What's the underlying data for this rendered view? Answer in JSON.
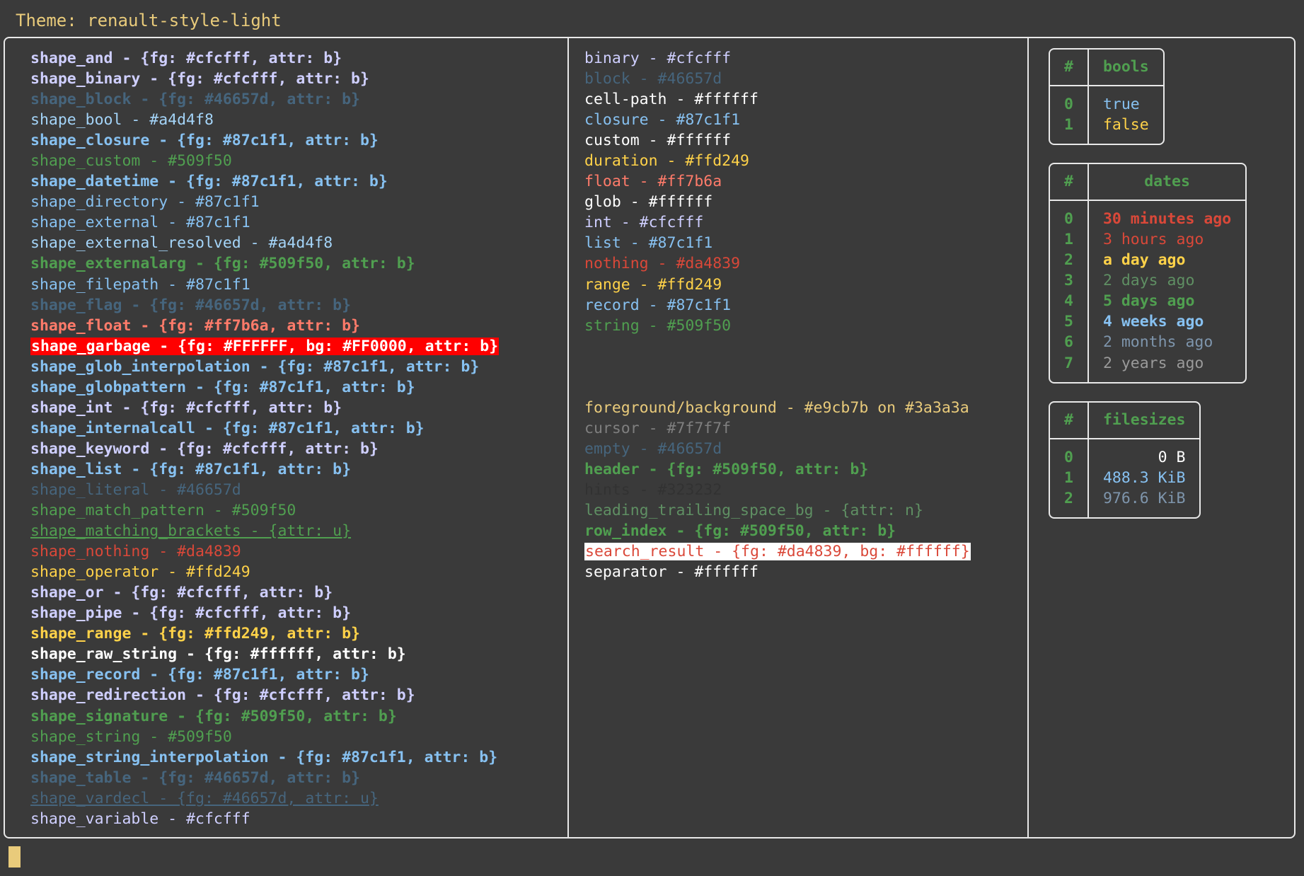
{
  "theme": {
    "title": "Theme: renault-style-light",
    "title_color": "#e9cb7b",
    "background": "#3a3a3a",
    "border_color": "#e8e8e8",
    "cursor_color": "#e9cb7b"
  },
  "shapes": [
    {
      "text": "shape_and - {fg: #cfcfff, attr: b}",
      "color": "#cfcfff",
      "bold": true
    },
    {
      "text": "shape_binary - {fg: #cfcfff, attr: b}",
      "color": "#cfcfff",
      "bold": true
    },
    {
      "text": "shape_block - {fg: #46657d, attr: b}",
      "color": "#46657d",
      "bold": true
    },
    {
      "text": "shape_bool - #a4d4f8",
      "color": "#a4d4f8",
      "bold": false
    },
    {
      "text": "shape_closure - {fg: #87c1f1, attr: b}",
      "color": "#87c1f1",
      "bold": true
    },
    {
      "text": "shape_custom - #509f50",
      "color": "#509f50",
      "bold": false
    },
    {
      "text": "shape_datetime - {fg: #87c1f1, attr: b}",
      "color": "#87c1f1",
      "bold": true
    },
    {
      "text": "shape_directory - #87c1f1",
      "color": "#87c1f1",
      "bold": false
    },
    {
      "text": "shape_external - #87c1f1",
      "color": "#87c1f1",
      "bold": false
    },
    {
      "text": "shape_external_resolved - #a4d4f8",
      "color": "#a4d4f8",
      "bold": false
    },
    {
      "text": "shape_externalarg - {fg: #509f50, attr: b}",
      "color": "#509f50",
      "bold": true
    },
    {
      "text": "shape_filepath - #87c1f1",
      "color": "#87c1f1",
      "bold": false
    },
    {
      "text": "shape_flag - {fg: #46657d, attr: b}",
      "color": "#46657d",
      "bold": true
    },
    {
      "text": "shape_float - {fg: #ff7b6a, attr: b}",
      "color": "#ff7b6a",
      "bold": true
    },
    {
      "text": "shape_garbage - {fg: #FFFFFF, bg: #FF0000, attr: b}",
      "color": "#FFFFFF",
      "bg": "#FF0000",
      "bold": true
    },
    {
      "text": "shape_glob_interpolation - {fg: #87c1f1, attr: b}",
      "color": "#87c1f1",
      "bold": true
    },
    {
      "text": "shape_globpattern - {fg: #87c1f1, attr: b}",
      "color": "#87c1f1",
      "bold": true
    },
    {
      "text": "shape_int - {fg: #cfcfff, attr: b}",
      "color": "#cfcfff",
      "bold": true
    },
    {
      "text": "shape_internalcall - {fg: #87c1f1, attr: b}",
      "color": "#87c1f1",
      "bold": true
    },
    {
      "text": "shape_keyword - {fg: #cfcfff, attr: b}",
      "color": "#cfcfff",
      "bold": true
    },
    {
      "text": "shape_list - {fg: #87c1f1, attr: b}",
      "color": "#87c1f1",
      "bold": true
    },
    {
      "text": "shape_literal - #46657d",
      "color": "#46657d",
      "bold": false
    },
    {
      "text": "shape_match_pattern - #509f50",
      "color": "#509f50",
      "bold": false
    },
    {
      "text": "shape_matching_brackets - {attr: u}",
      "color": "#509f50",
      "bold": false,
      "underline": true
    },
    {
      "text": "shape_nothing - #da4839",
      "color": "#da4839",
      "bold": false
    },
    {
      "text": "shape_operator - #ffd249",
      "color": "#ffd249",
      "bold": false
    },
    {
      "text": "shape_or - {fg: #cfcfff, attr: b}",
      "color": "#cfcfff",
      "bold": true
    },
    {
      "text": "shape_pipe - {fg: #cfcfff, attr: b}",
      "color": "#cfcfff",
      "bold": true
    },
    {
      "text": "shape_range - {fg: #ffd249, attr: b}",
      "color": "#ffd249",
      "bold": true
    },
    {
      "text": "shape_raw_string - {fg: #ffffff, attr: b}",
      "color": "#ffffff",
      "bold": true
    },
    {
      "text": "shape_record - {fg: #87c1f1, attr: b}",
      "color": "#87c1f1",
      "bold": true
    },
    {
      "text": "shape_redirection - {fg: #cfcfff, attr: b}",
      "color": "#cfcfff",
      "bold": true
    },
    {
      "text": "shape_signature - {fg: #509f50, attr: b}",
      "color": "#509f50",
      "bold": true
    },
    {
      "text": "shape_string - #509f50",
      "color": "#509f50",
      "bold": false
    },
    {
      "text": "shape_string_interpolation - {fg: #87c1f1, attr: b}",
      "color": "#87c1f1",
      "bold": true
    },
    {
      "text": "shape_table - {fg: #46657d, attr: b}",
      "color": "#46657d",
      "bold": true
    },
    {
      "text": "shape_vardecl - {fg: #46657d, attr: u}",
      "color": "#46657d",
      "bold": false,
      "underline": true
    },
    {
      "text": "shape_variable - #cfcfff",
      "color": "#cfcfff",
      "bold": false
    }
  ],
  "types": [
    {
      "text": "binary - #cfcfff",
      "color": "#cfcfff",
      "bold": false
    },
    {
      "text": "block - #46657d",
      "color": "#46657d",
      "bold": false
    },
    {
      "text": "cell-path - #ffffff",
      "color": "#ffffff",
      "bold": false
    },
    {
      "text": "closure - #87c1f1",
      "color": "#87c1f1",
      "bold": false
    },
    {
      "text": "custom - #ffffff",
      "color": "#ffffff",
      "bold": false
    },
    {
      "text": "duration - #ffd249",
      "color": "#ffd249",
      "bold": false
    },
    {
      "text": "float - #ff7b6a",
      "color": "#ff7b6a",
      "bold": false
    },
    {
      "text": "glob - #ffffff",
      "color": "#ffffff",
      "bold": false
    },
    {
      "text": "int - #cfcfff",
      "color": "#cfcfff",
      "bold": false
    },
    {
      "text": "list - #87c1f1",
      "color": "#87c1f1",
      "bold": false
    },
    {
      "text": "nothing - #da4839",
      "color": "#da4839",
      "bold": false
    },
    {
      "text": "range - #ffd249",
      "color": "#ffd249",
      "bold": false
    },
    {
      "text": "record - #87c1f1",
      "color": "#87c1f1",
      "bold": false
    },
    {
      "text": "string - #509f50",
      "color": "#509f50",
      "bold": false
    }
  ],
  "ui_elements": [
    {
      "text": "foreground/background - #e9cb7b on #3a3a3a",
      "color": "#e9cb7b",
      "bold": false
    },
    {
      "text": "cursor - #7f7f7f",
      "color": "#7f7f7f",
      "bold": false
    },
    {
      "text": "empty - #46657d",
      "color": "#46657d",
      "bold": false
    },
    {
      "text": "header - {fg: #509f50, attr: b}",
      "color": "#509f50",
      "bold": true
    },
    {
      "text": "hints - #323232",
      "color": "#323232",
      "bold": false
    },
    {
      "text": "leading_trailing_space_bg - {attr: n}",
      "color": "#5f8f63",
      "bold": false
    },
    {
      "text": "row_index - {fg: #509f50, attr: b}",
      "color": "#509f50",
      "bold": true
    },
    {
      "text": "search_result - {fg: #da4839, bg: #ffffff}",
      "color": "#da4839",
      "bg": "#ffffff",
      "bold": false
    },
    {
      "text": "separator - #ffffff",
      "color": "#ffffff",
      "bold": false
    }
  ],
  "tables": [
    {
      "name": "bools",
      "index_header": "#",
      "value_header": "bools",
      "header_align": "center",
      "value_align": "left",
      "rows": [
        {
          "index": "0",
          "value": "true",
          "color": "#87c1f1",
          "bold": false
        },
        {
          "index": "1",
          "value": "false",
          "color": "#ffd249",
          "bold": false
        }
      ]
    },
    {
      "name": "dates",
      "index_header": "#",
      "value_header": "dates",
      "header_align": "center",
      "value_align": "left",
      "rows": [
        {
          "index": "0",
          "value": "30 minutes ago",
          "color": "#da4839",
          "bold": true
        },
        {
          "index": "1",
          "value": "3 hours ago",
          "color": "#da4839",
          "bold": false
        },
        {
          "index": "2",
          "value": "a day ago",
          "color": "#ffd249",
          "bold": true
        },
        {
          "index": "3",
          "value": "2 days ago",
          "color": "#5f8f63",
          "bold": false
        },
        {
          "index": "4",
          "value": "5 days ago",
          "color": "#509f50",
          "bold": true
        },
        {
          "index": "5",
          "value": "4 weeks ago",
          "color": "#87c1f1",
          "bold": true
        },
        {
          "index": "6",
          "value": "2 months ago",
          "color": "#7e95ac",
          "bold": false
        },
        {
          "index": "7",
          "value": "2 years ago",
          "color": "#9a9a9a",
          "bold": false
        }
      ]
    },
    {
      "name": "filesizes",
      "index_header": "#",
      "value_header": "filesizes",
      "header_align": "center",
      "value_align": "right",
      "rows": [
        {
          "index": "0",
          "value": "0 B",
          "color": "#ffffff",
          "bold": false
        },
        {
          "index": "1",
          "value": "488.3 KiB",
          "color": "#87c1f1",
          "bold": false
        },
        {
          "index": "2",
          "value": "976.6 KiB",
          "color": "#7e95ac",
          "bold": false
        }
      ]
    }
  ]
}
